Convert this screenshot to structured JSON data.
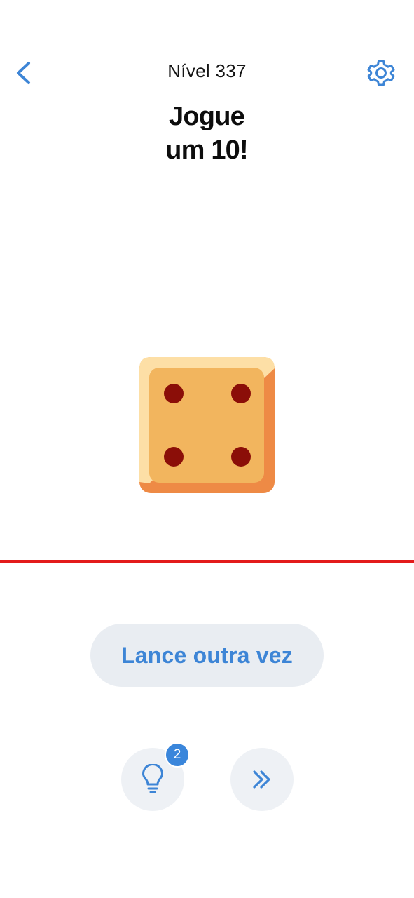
{
  "header": {
    "back_icon": "chevron-left-icon",
    "level_title": "Nível 337",
    "settings_icon": "gear-icon"
  },
  "puzzle": {
    "title_line1": "Jogue",
    "title_line2": "um 10!"
  },
  "die": {
    "face_value": 4,
    "colors": {
      "face": "#F2B55E",
      "highlight": "#FDDFA6",
      "shadow": "#EE8A45",
      "pip": "#8B0E08"
    }
  },
  "limit_line": {
    "color": "#E31B1B"
  },
  "actions": {
    "reroll_label": "Lance outra vez",
    "hint_icon": "lightbulb-icon",
    "hint_count": "2",
    "skip_icon": "double-chevron-right-icon"
  },
  "colors": {
    "accent": "#3D85D6",
    "button_bg": "#E9EDF2"
  }
}
